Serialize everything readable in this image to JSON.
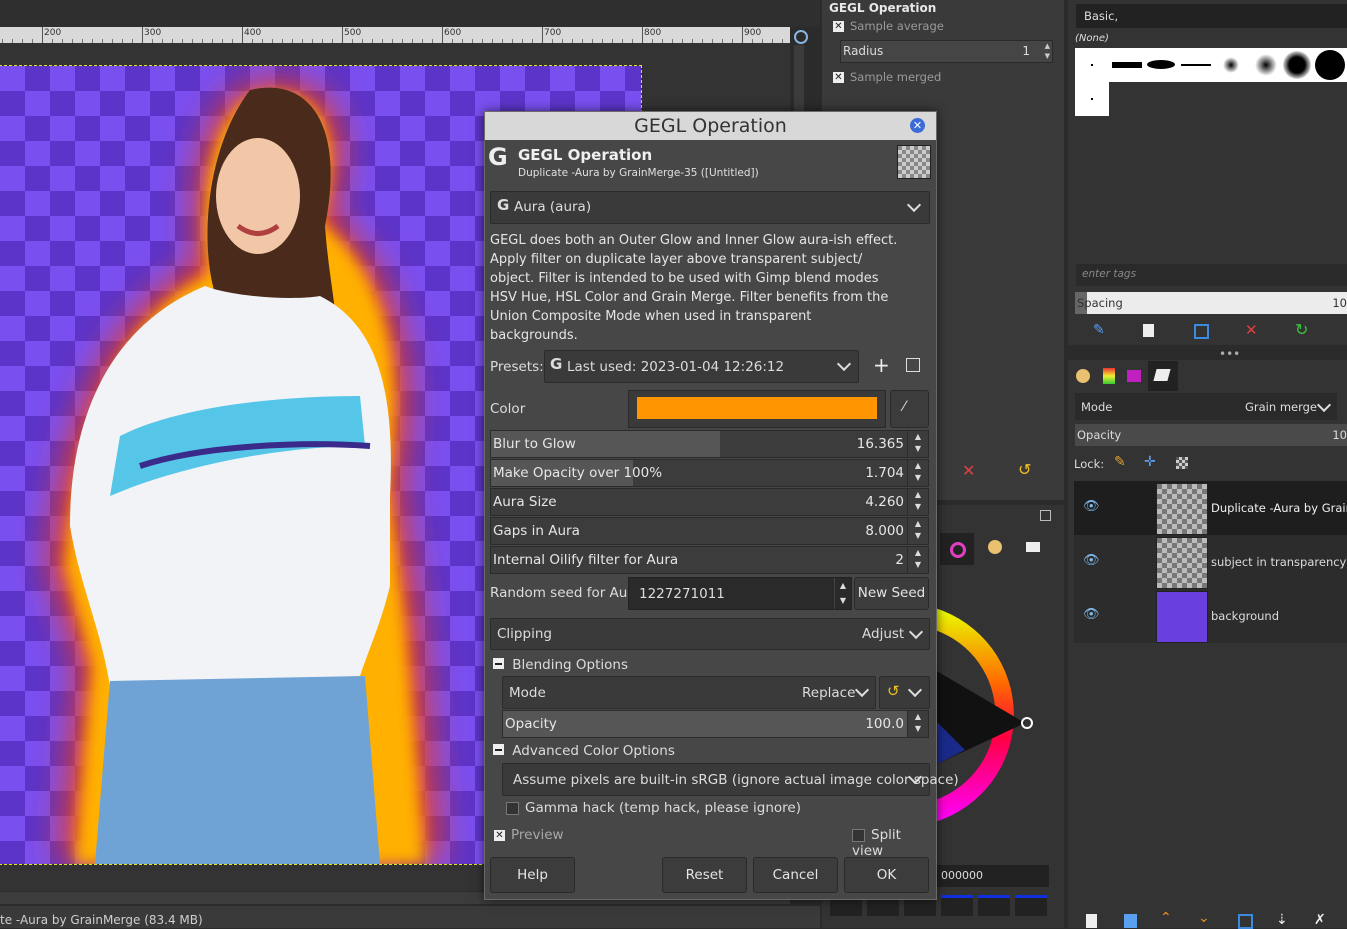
{
  "ruler": {
    "labels": [
      "200",
      "300",
      "400",
      "500",
      "600",
      "700",
      "800",
      "900"
    ]
  },
  "status": {
    "text": "te -Aura by GrainMerge (83.4 MB)"
  },
  "tool_options": {
    "title": "GEGL Operation",
    "sample_average": "Sample average",
    "radius_label": "Radius",
    "radius_value": "1",
    "sample_merged": "Sample merged"
  },
  "brushes": {
    "filter": "Basic,",
    "none": "(None)",
    "tags_placeholder": "enter tags",
    "spacing_label": "Spacing",
    "spacing_value": "10"
  },
  "layers": {
    "mode_label": "Mode",
    "mode_value": "Grain merge",
    "opacity_label": "Opacity",
    "opacity_value": "10",
    "lock_label": "Lock:",
    "items": [
      {
        "name": "Duplicate -Aura by GrainM"
      },
      {
        "name": "subject in transparency"
      },
      {
        "name": "background"
      }
    ]
  },
  "colors": {
    "hex": "000000",
    "accent": "#ff9500",
    "bg_purple": "#7a4ff0"
  },
  "dialog": {
    "title": "GEGL Operation",
    "header_title": "GEGL Operation",
    "header_sub": "Duplicate -Aura by GrainMerge-35 ([Untitled])",
    "operation": "Aura (aura)",
    "description_lines": [
      "GEGL does both an Outer Glow and Inner Glow aura-ish effect.",
      "Apply filter on duplicate layer above transparent subject/",
      "object. Filter is intended to be used with Gimp blend modes",
      "HSV Hue, HSL Color and Grain Merge. Filter benefits from the",
      "Union Composite Mode when used in transparent",
      "backgrounds."
    ],
    "presets_label": "Presets:",
    "presets_value": "Last used: 2023-01-04 12:26:12",
    "color_label": "Color",
    "sliders": [
      {
        "label": "Blur to Glow",
        "value": "16.365",
        "fill": 0.55
      },
      {
        "label": "Make Opacity over 100%",
        "value": "1.704",
        "fill": 0.34
      },
      {
        "label": "Aura Size",
        "value": "4.260",
        "fill": 0.0
      },
      {
        "label": "Gaps in Aura",
        "value": "8.000",
        "fill": 0.0
      },
      {
        "label": "Internal Oilify filter for Aura",
        "value": "2",
        "fill": 0.0
      }
    ],
    "seed_label": "Random seed for Aura",
    "seed_value": "1227271011",
    "new_seed": "New Seed",
    "clipping_label": "Clipping",
    "clipping_value": "Adjust",
    "blending_header": "Blending Options",
    "mode_label": "Mode",
    "mode_value": "Replace",
    "opacity_label": "Opacity",
    "opacity_value": "100.0",
    "advanced_header": "Advanced Color Options",
    "color_space": "Assume pixels are built-in sRGB (ignore actual image color space)",
    "gamma_hack": "Gamma hack (temp hack, please ignore)",
    "preview": "Preview",
    "split_view": "Split view",
    "buttons": {
      "help": "Help",
      "reset": "Reset",
      "cancel": "Cancel",
      "ok": "OK"
    }
  }
}
